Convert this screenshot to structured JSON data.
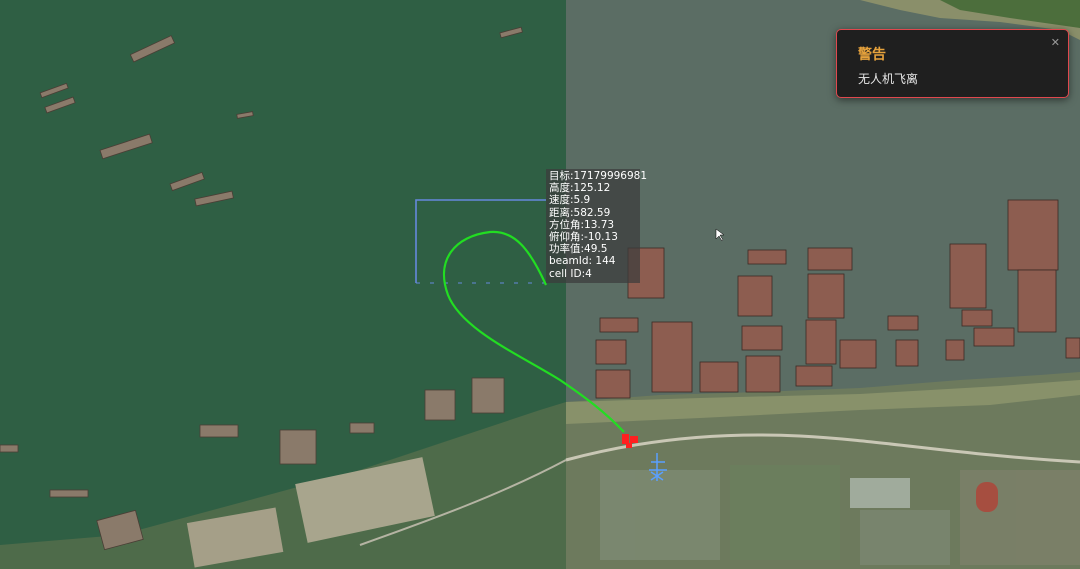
{
  "target_info": {
    "lines": [
      "目标:17179996981",
      "高度:125.12",
      "速度:5.9",
      "距离:582.59",
      "方位角:13.73",
      "俯仰角:-10.13",
      "功率值:49.5",
      "beamId: 144",
      "cell ID:4"
    ]
  },
  "alert": {
    "title": "警告",
    "message": "无人机飞离",
    "close_icon": "close-icon"
  },
  "colors": {
    "water_left": "#2f5f44",
    "water_right": "#5b6d64",
    "track": "#22dd22",
    "sector": "#6688dd",
    "alert_border": "#e0484e",
    "alert_title": "#e6a23c",
    "drone": "#ff2020",
    "radar": "#5aa0ff"
  },
  "icons": {
    "drone_marker": "drone-icon",
    "radar_station": "radar-icon",
    "cursor": "mouse-cursor-icon"
  }
}
